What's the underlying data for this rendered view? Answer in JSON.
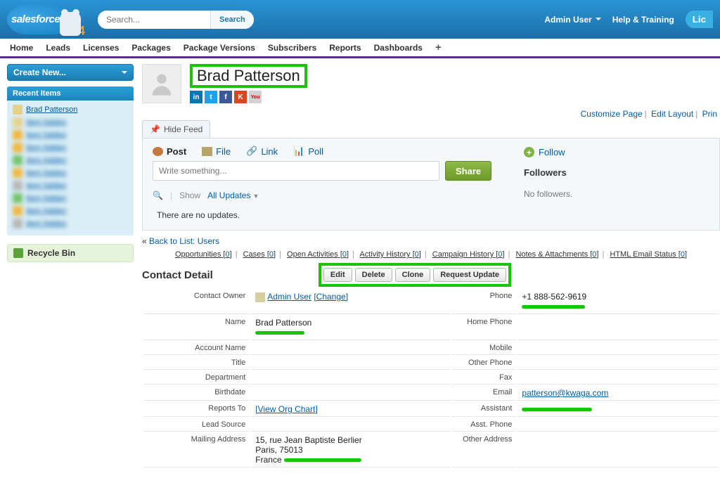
{
  "header": {
    "logo_text": "salesforce",
    "year": "14",
    "search_placeholder": "Search...",
    "search_button": "Search",
    "admin_user": "Admin User",
    "help": "Help & Training",
    "license": "Lic"
  },
  "nav": [
    "Home",
    "Leads",
    "Licenses",
    "Packages",
    "Package Versions",
    "Subscribers",
    "Reports",
    "Dashboards"
  ],
  "sidebar": {
    "create_new": "Create New...",
    "recent_title": "Recent Items",
    "recent_first": "Brad Patterson",
    "recycle": "Recycle Bin"
  },
  "page": {
    "title": "Brad Patterson",
    "hide_feed": "Hide Feed",
    "post_tabs": {
      "post": "Post",
      "file": "File",
      "link": "Link",
      "poll": "Poll"
    },
    "compose_placeholder": "Write something...",
    "share": "Share",
    "follow": "Follow",
    "followers": "Followers",
    "no_followers": "No followers.",
    "show_label": "Show",
    "all_updates": "All Updates",
    "no_updates": "There are no updates.",
    "back_link": "Back to List: Users",
    "customize": "Customize Page",
    "edit_layout": "Edit Layout",
    "print": "Prin"
  },
  "related": [
    {
      "name": "Opportunities",
      "count": "0"
    },
    {
      "name": "Cases",
      "count": "0"
    },
    {
      "name": "Open Activities",
      "count": "0"
    },
    {
      "name": "Activity History",
      "count": "0"
    },
    {
      "name": "Campaign History",
      "count": "0"
    },
    {
      "name": "Notes & Attachments",
      "count": "0"
    },
    {
      "name": "HTML Email Status",
      "count": "0"
    }
  ],
  "detail": {
    "heading": "Contact Detail",
    "buttons": [
      "Edit",
      "Delete",
      "Clone",
      "Request Update"
    ],
    "owner_label": "Contact Owner",
    "owner_value": "Admin User",
    "owner_change": "[Change]",
    "name_label": "Name",
    "name_value": "Brad Patterson",
    "account_label": "Account Name",
    "title_label": "Title",
    "dept_label": "Department",
    "birth_label": "Birthdate",
    "reports_label": "Reports To",
    "reports_link": "[View Org Chart]",
    "lead_label": "Lead Source",
    "mail_label": "Mailing Address",
    "mail_line1": "15, rue Jean Baptiste Berlier",
    "mail_line2": "Paris, 75013",
    "mail_line3": "France",
    "phone_label": "Phone",
    "phone_value": "+1 888-562-9619",
    "hphone_label": "Home Phone",
    "mobile_label": "Mobile",
    "ophone_label": "Other Phone",
    "fax_label": "Fax",
    "email_label": "Email",
    "email_value": "patterson@kwaga.com",
    "asst_label": "Assistant",
    "aphone_label": "Asst. Phone",
    "oaddr_label": "Other Address"
  }
}
